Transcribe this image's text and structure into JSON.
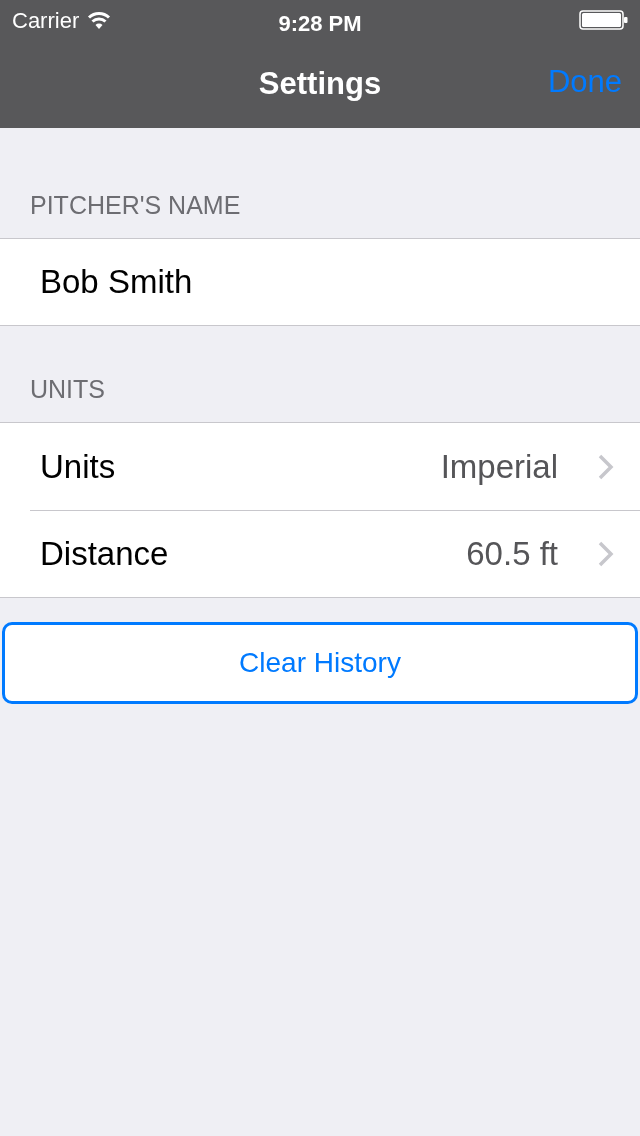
{
  "status_bar": {
    "carrier": "Carrier",
    "time": "9:28 PM"
  },
  "nav_bar": {
    "title": "Settings",
    "done": "Done"
  },
  "name_section": {
    "header": "PITCHER'S NAME",
    "field": {
      "value": "Bob Smith"
    }
  },
  "units_section": {
    "header": "UNITS",
    "rows": [
      {
        "label": "Units",
        "value": "Imperial"
      },
      {
        "label": "Distance",
        "value": "60.5 ft"
      }
    ]
  },
  "action_button": {
    "label": "Clear History"
  }
}
